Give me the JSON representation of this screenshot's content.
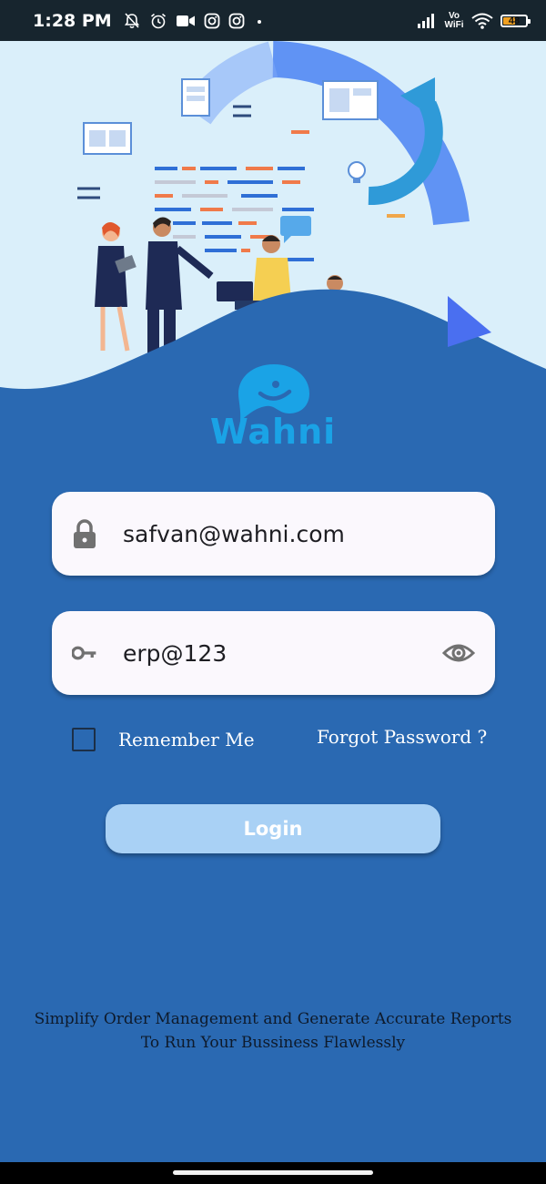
{
  "status_bar": {
    "time": "1:28 PM",
    "network_label_top": "Vo",
    "network_label_bottom": "WiFi",
    "battery_level": "48",
    "icons": [
      "notifications-off-icon",
      "alarm-icon",
      "video-camera-icon",
      "instagram-icon",
      "instagram-icon",
      "dot-icon",
      "signal-icon",
      "wifi-icon",
      "battery-icon"
    ]
  },
  "brand": {
    "name": "Wahni",
    "color": "#1aa3e6"
  },
  "login_form": {
    "email": {
      "value": "safvan@wahni.com",
      "icon": "lock-icon"
    },
    "password": {
      "value": "erp@123",
      "icon": "key-icon",
      "toggle_icon": "eye-icon"
    },
    "remember_label": "Remember Me",
    "remember_checked": false,
    "forgot_label": "Forgot Password ?",
    "login_label": "Login"
  },
  "tagline": {
    "line1": "Simplify Order Management and Generate Accurate Reports",
    "line2": "To Run Your Bussiness Flawlessly"
  },
  "colors": {
    "background": "#2a69b2",
    "hero_background": "#daeffa",
    "field_background": "#fbf8fd",
    "login_button": "#a9d1f5",
    "status_bar": "#17252e"
  }
}
